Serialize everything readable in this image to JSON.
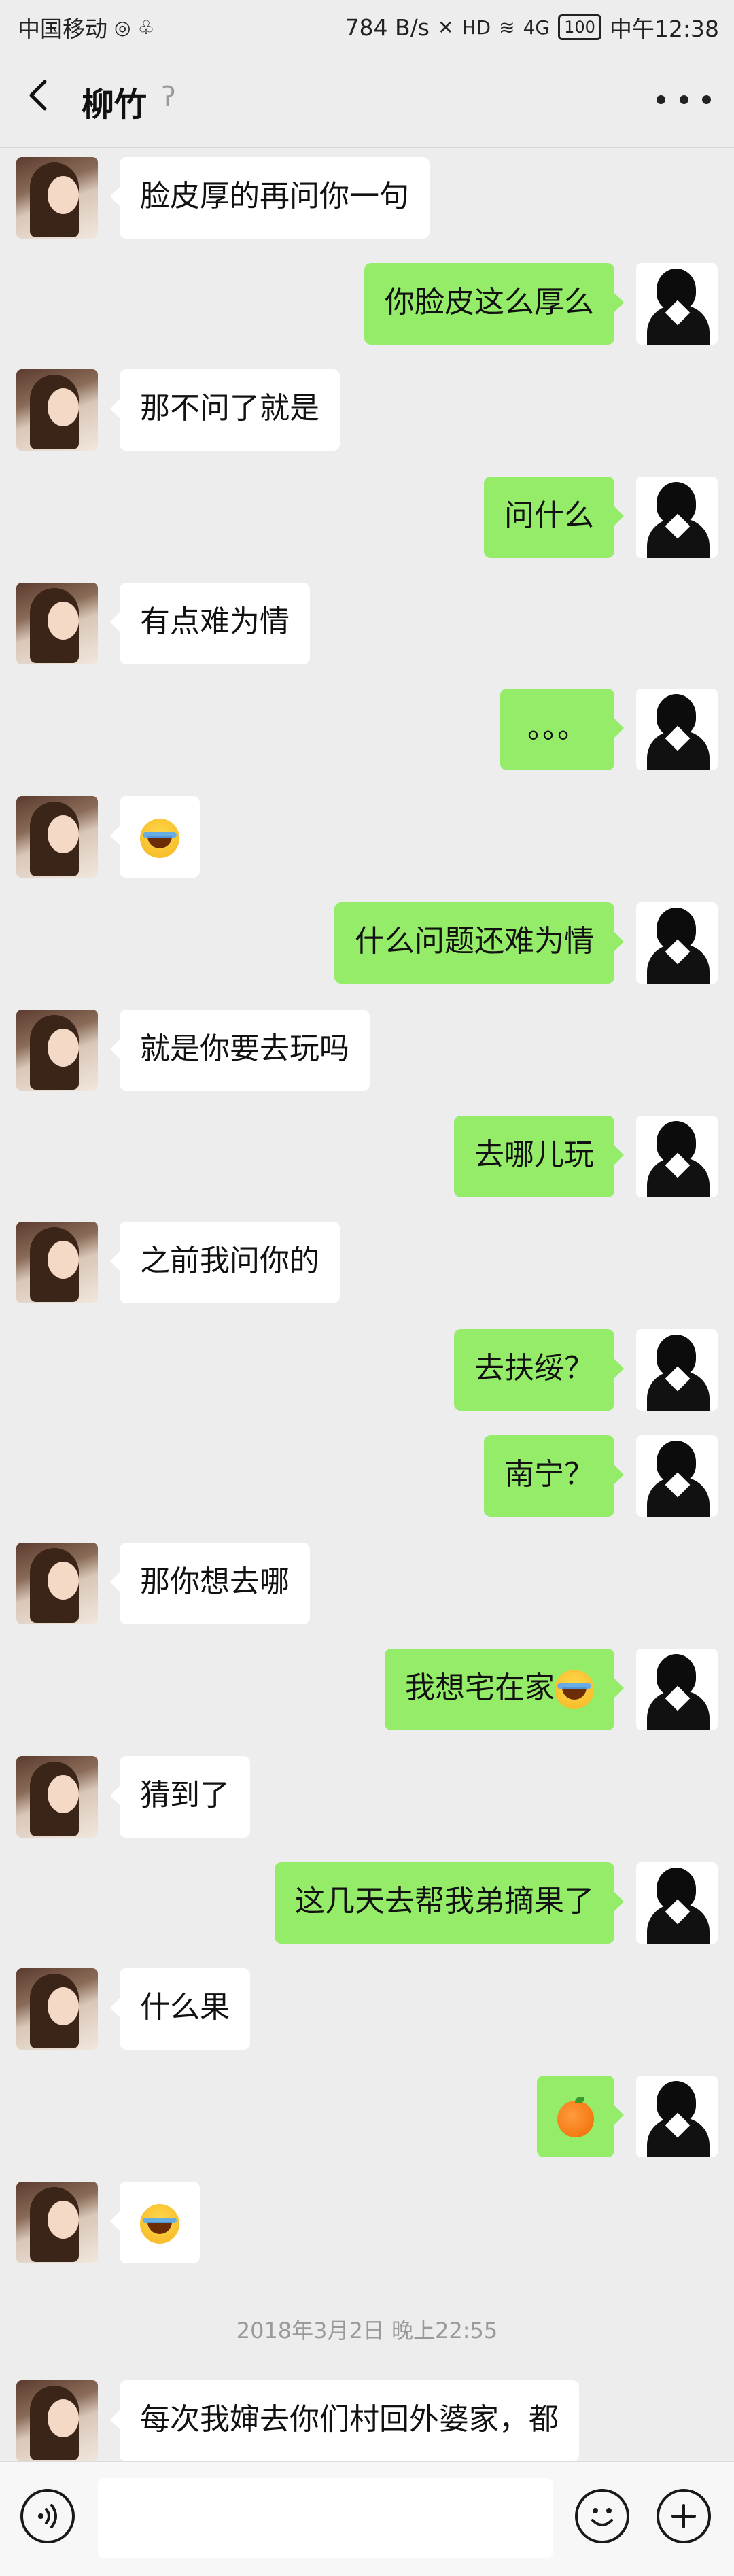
{
  "status_bar": {
    "carrier": "中国移动",
    "speed": "784 B/s",
    "signal": "4G",
    "battery": "100",
    "time": "中午12:38"
  },
  "header": {
    "title": "柳竹",
    "back_icon": "chevron-left-icon",
    "mute_icon": "ear-icon",
    "more_icon": "more-dots-icon"
  },
  "messages": [
    {
      "side": "left",
      "text": "脸皮厚的再问你一句"
    },
    {
      "side": "right",
      "text": "你脸皮这么厚么"
    },
    {
      "side": "left",
      "text": "那不问了就是"
    },
    {
      "side": "right",
      "text": "问什么"
    },
    {
      "side": "left",
      "text": "有点难为情"
    },
    {
      "side": "right",
      "text": "。。。"
    },
    {
      "side": "left",
      "emoji": "laugh-cry-emoji"
    },
    {
      "side": "right",
      "text": "什么问题还难为情"
    },
    {
      "side": "left",
      "text": "就是你要去玩吗"
    },
    {
      "side": "right",
      "text": "去哪儿玩"
    },
    {
      "side": "left",
      "text": "之前我问你的"
    },
    {
      "side": "right",
      "text": "去扶绥？"
    },
    {
      "side": "right",
      "text": "南宁？"
    },
    {
      "side": "left",
      "text": "那你想去哪"
    },
    {
      "side": "right",
      "text": "我想宅在家",
      "emoji": "laugh-cry-emoji"
    },
    {
      "side": "left",
      "text": "猜到了"
    },
    {
      "side": "right",
      "text": "这几天去帮我弟摘果了"
    },
    {
      "side": "left",
      "text": "什么果"
    },
    {
      "side": "right",
      "emoji": "orange-emoji"
    },
    {
      "side": "left",
      "emoji": "laugh-cry-emoji"
    },
    {
      "timestamp": "2018年3月2日 晚上22:55"
    },
    {
      "side": "left",
      "text": "每次我婶去你们村回外婆家，都"
    }
  ],
  "input_bar": {
    "voice_icon": "voice-icon",
    "emoji_icon": "emoji-icon",
    "plus_icon": "plus-icon",
    "input_value": ""
  }
}
